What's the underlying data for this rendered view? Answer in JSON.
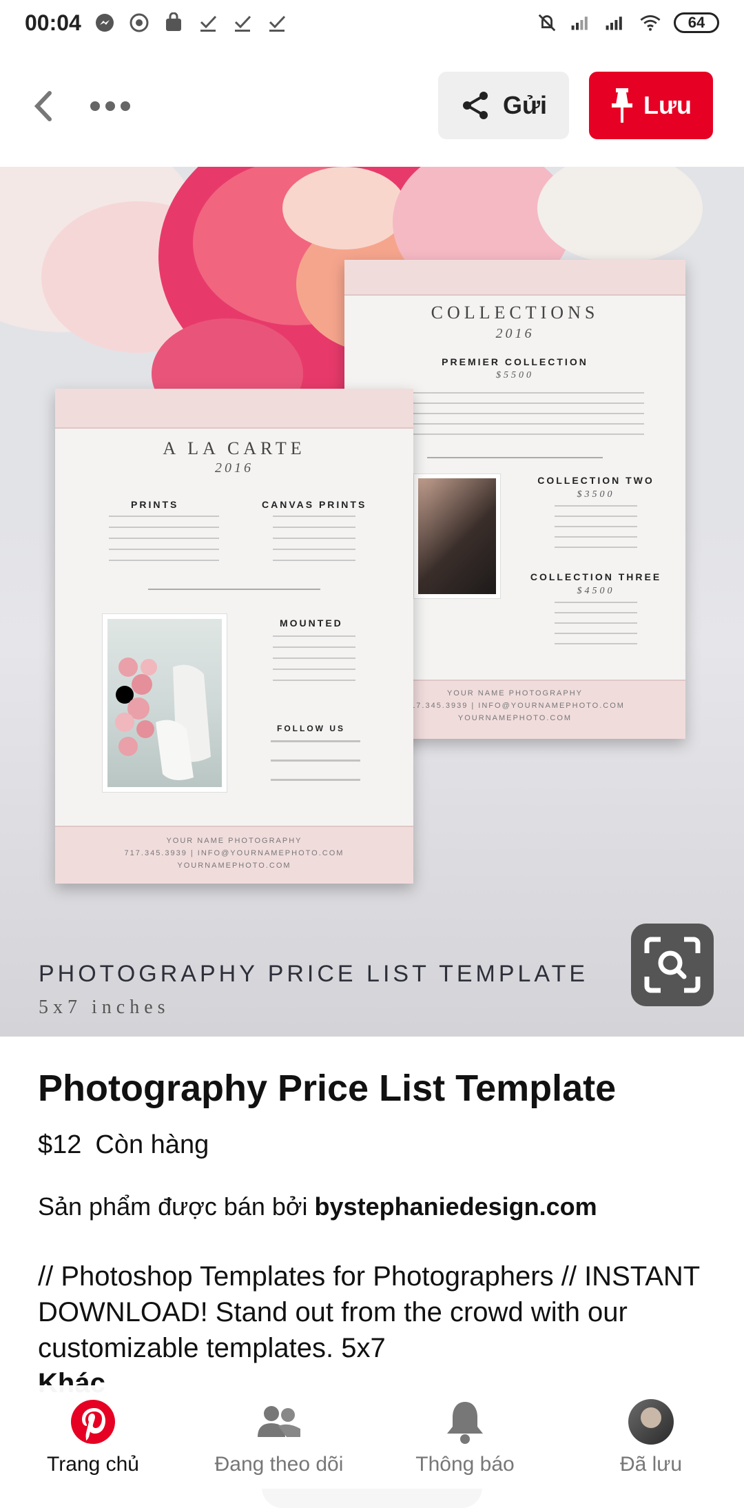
{
  "status_bar": {
    "time": "00:04",
    "battery": "64"
  },
  "top_bar": {
    "send_label": "Gửi",
    "save_label": "Lưu"
  },
  "pin_image": {
    "left_card": {
      "title": "A LA CARTE",
      "year": "2016",
      "prints_heading": "PRINTS",
      "canvas_heading": "CANVAS PRINTS",
      "mounted_heading": "MOUNTED",
      "follow_heading": "FOLLOW US",
      "footer": [
        "YOUR NAME PHOTOGRAPHY",
        "717.345.3939 | INFO@YOURNAMEPHOTO.COM",
        "YOURNAMEPHOTO.COM"
      ]
    },
    "right_card": {
      "title": "COLLECTIONS",
      "year": "2016",
      "premier_heading": "PREMIER COLLECTION",
      "premier_price": "$5500",
      "two_heading": "COLLECTION TWO",
      "two_price": "$3500",
      "three_heading": "COLLECTION THREE",
      "three_price": "$4500",
      "footer": [
        "YOUR NAME PHOTOGRAPHY",
        "717.345.3939 | INFO@YOURNAMEPHOTO.COM",
        "YOURNAMEPHOTO.COM"
      ]
    },
    "caption": "PHOTOGRAPHY PRICE LIST TEMPLATE",
    "caption_sub": "5x7 inches"
  },
  "pin_details": {
    "title": "Photography Price List Template",
    "price": "$12",
    "stock": "Còn hàng",
    "seller_prefix": "Sản phẩm được bán bởi ",
    "seller_name": "bystephaniedesign.com",
    "description": "// Photoshop Templates for Photographers // INSTANT DOWNLOAD!  Stand out from the crowd with our customizable templates.  5x7",
    "cut_text": "Khác"
  },
  "bottom_nav": {
    "items": [
      {
        "label": "Trang chủ"
      },
      {
        "label": "Đang theo dõi"
      },
      {
        "label": "Thông báo"
      },
      {
        "label": "Đã lưu"
      }
    ]
  },
  "colors": {
    "brand_red": "#e60023",
    "pink_band": "#f1dcdc"
  }
}
